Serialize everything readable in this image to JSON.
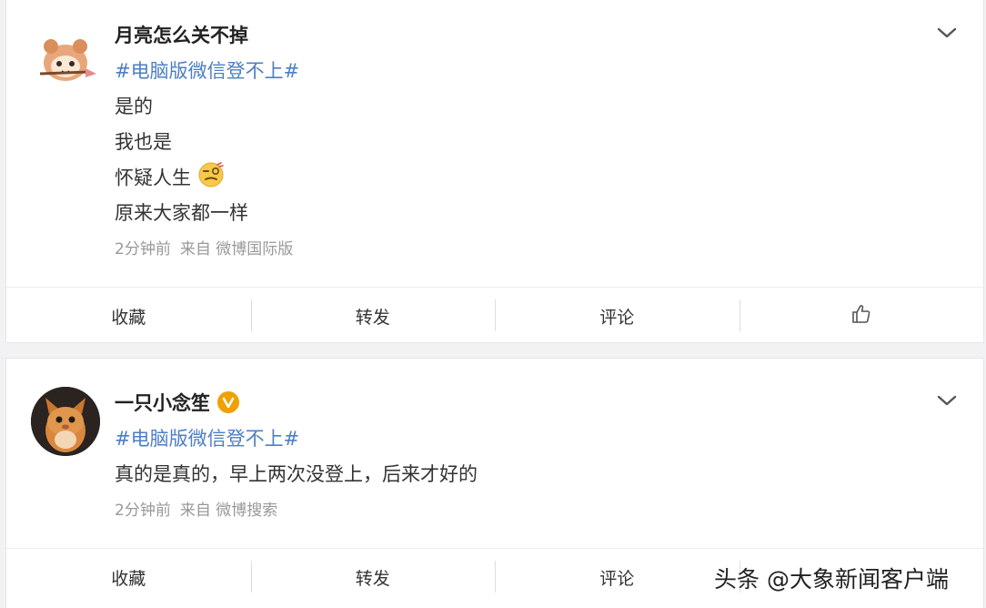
{
  "posts": [
    {
      "username": "月亮怎么关不掉",
      "topic": "#电脑版微信登不上#",
      "lines": [
        "是的",
        "我也是",
        "怀疑人生",
        "原来大家都一样"
      ],
      "emoji_icon": "dizzy-face-emoji-icon",
      "time": "2分钟前",
      "source": "来自 微博国际版",
      "actions": {
        "favorite": "收藏",
        "repost": "转发",
        "comment": "评论"
      }
    },
    {
      "username": "一只小念笙",
      "verified": true,
      "topic": "#电脑版微信登不上#",
      "lines": [
        "真的是真的，早上两次没登上，后来才好的"
      ],
      "time": "2分钟前",
      "source": "来自 微博搜索",
      "actions": {
        "favorite": "收藏",
        "repost": "转发",
        "comment": "评论"
      }
    }
  ],
  "watermark": "头条 @大象新闻客户端",
  "colors": {
    "topic": "#4d7fc3",
    "verified_badge": "#f0a000",
    "meta": "#999999"
  },
  "icons": [
    "chevron-down-icon",
    "like-thumb-icon",
    "verified-v-icon"
  ]
}
